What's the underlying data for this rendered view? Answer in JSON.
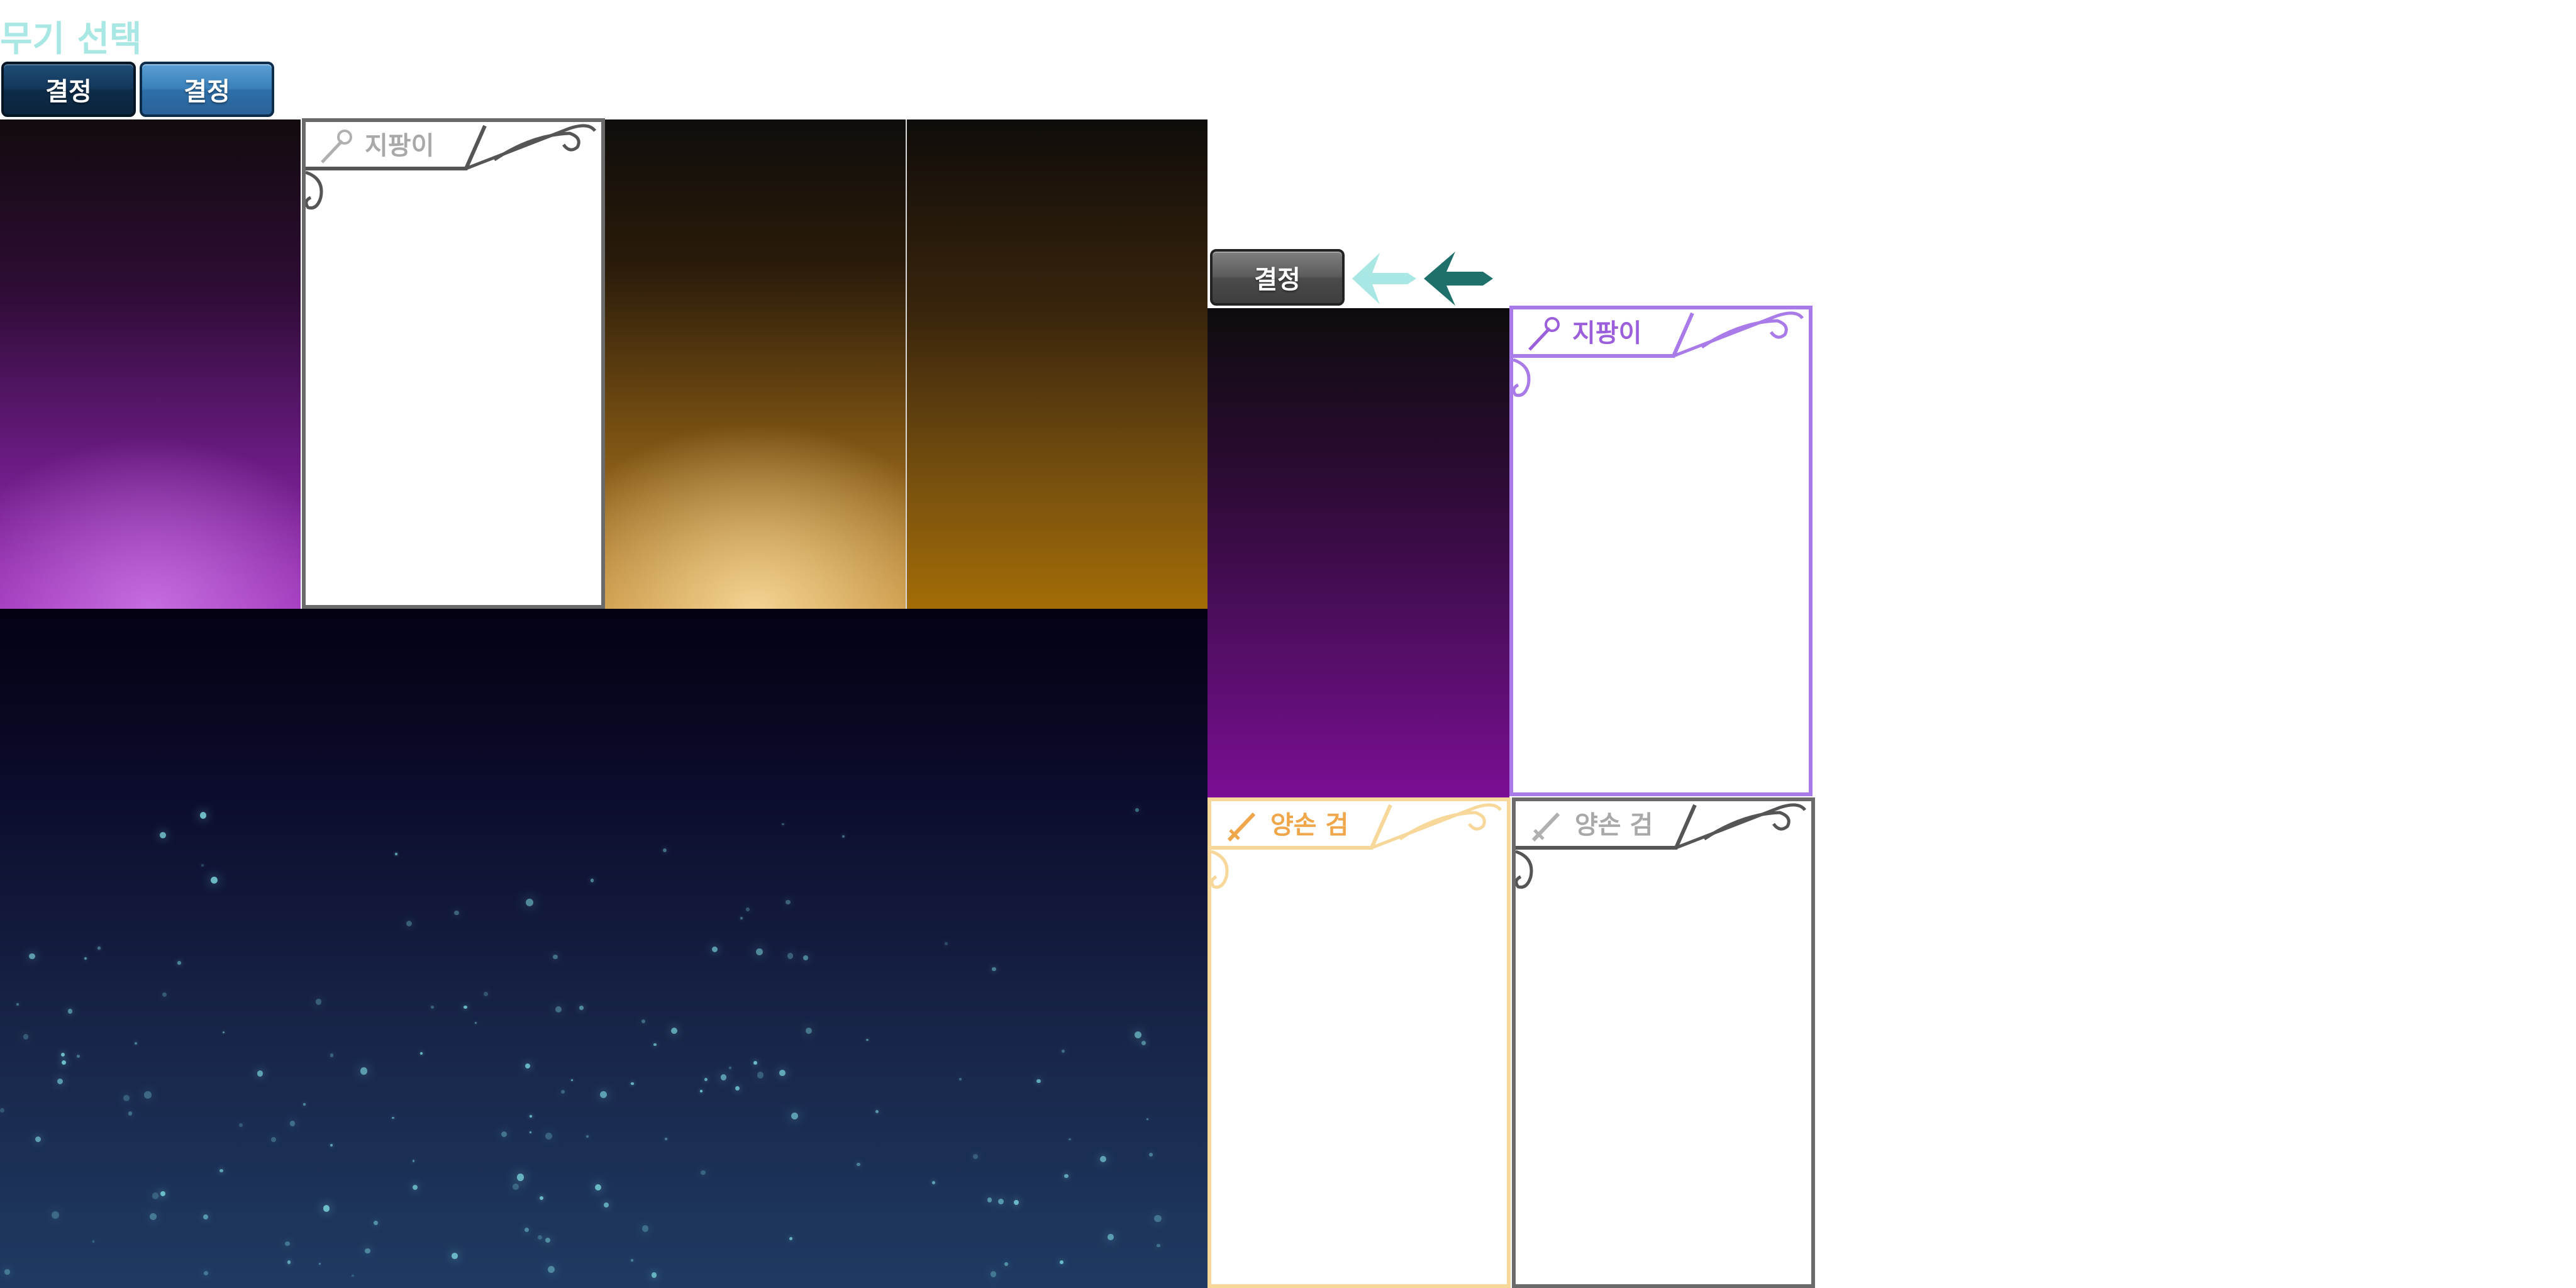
{
  "screen": {
    "title": "무기 선택"
  },
  "buttons": {
    "confirm_dark": "결정",
    "confirm_light": "결정",
    "confirm_gray": "결정"
  },
  "cards": {
    "staff_gray": {
      "label": "지팡이",
      "icon": "staff-icon",
      "color": "#555555",
      "label_color": "#a8a8a8"
    },
    "staff_purple": {
      "label": "지팡이",
      "icon": "staff-icon",
      "color": "#a87be8",
      "label_color": "#9c5fdb"
    },
    "sword_gold": {
      "label": "양손 검",
      "icon": "sword-icon",
      "color": "#f7d89a",
      "label_color": "#f0a64a"
    },
    "sword_gray": {
      "label": "양손 검",
      "icon": "sword-icon",
      "color": "#555555",
      "label_color": "#a8a8a8"
    }
  },
  "arrows": {
    "light": {
      "icon": "arrow-left-icon",
      "color": "#a9e7e4"
    },
    "dark": {
      "icon": "arrow-left-icon",
      "color": "#1f6f6a"
    }
  },
  "backgrounds": {
    "purple_glow": "purple-glow-background",
    "gold_glow": "gold-glow-background",
    "gold_plain": "gold-background",
    "purple_plain": "purple-background",
    "night_sky": "starry-night-background"
  }
}
